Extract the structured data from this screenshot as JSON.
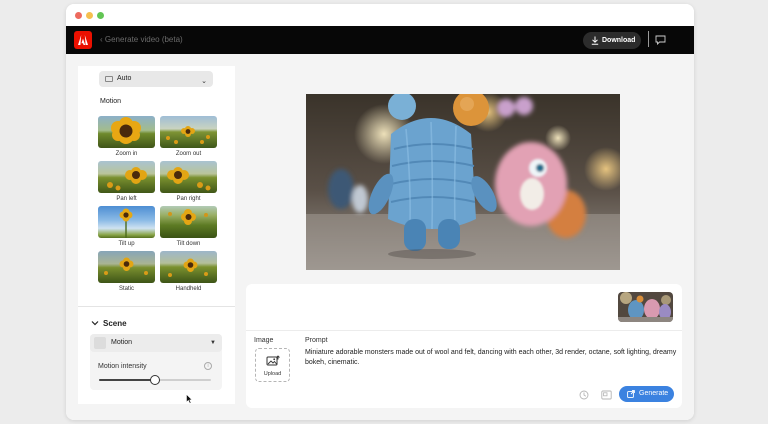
{
  "window": {
    "dot_colors": [
      "#ed6a5e",
      "#f5bf4f",
      "#62c554"
    ]
  },
  "appbar": {
    "breadcrumb": "‹  Generate video (beta)",
    "download_label": "Download",
    "accent": "#eb1000"
  },
  "sidebar": {
    "camera_select": "Auto",
    "motion_heading": "Motion",
    "motion_options": [
      {
        "label": "Zoom in"
      },
      {
        "label": "Zoom out"
      },
      {
        "label": "Pan left"
      },
      {
        "label": "Pan right"
      },
      {
        "label": "Tilt up"
      },
      {
        "label": "Tilt down"
      },
      {
        "label": "Static"
      },
      {
        "label": "Handheld"
      }
    ],
    "scene_heading": "Scene",
    "scene_select": "Motion",
    "intensity_label": "Motion intensity",
    "intensity_value": 0.5
  },
  "prompt": {
    "image_label": "Image",
    "upload_label": "Upload",
    "prompt_label": "Prompt",
    "prompt_text": "Miniature adorable monsters made out of wool and felt, dancing with each other, 3d render, octane, soft lighting, dreamy bokeh, cinematic.",
    "generate_label": "Generate",
    "generate_color": "#3b82e0"
  }
}
